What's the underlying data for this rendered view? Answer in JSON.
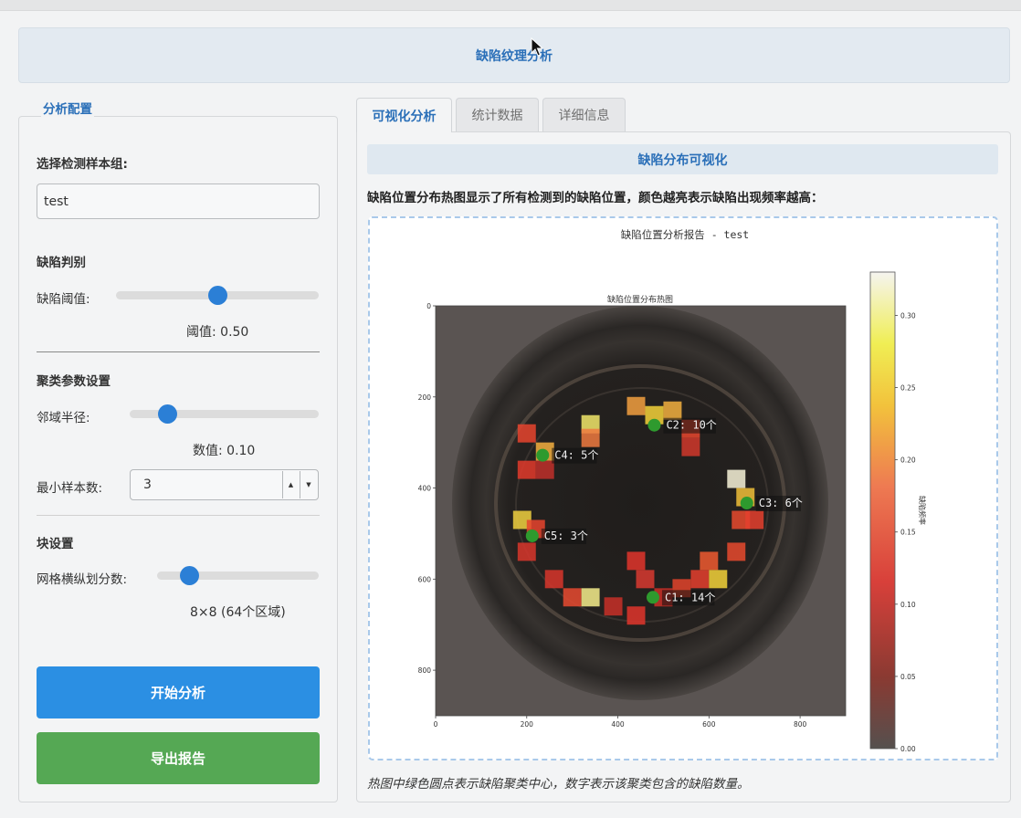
{
  "header": {
    "title": "缺陷纹理分析"
  },
  "config": {
    "group_title": "分析配置",
    "sample_group_label": "选择检测样本组:",
    "sample_group_value": "test",
    "defect_section": "缺陷判别",
    "threshold_label": "缺陷阈值:",
    "threshold_value": 0.5,
    "threshold_text": "阈值: 0.50",
    "cluster_section": "聚类参数设置",
    "radius_label": "邻域半径:",
    "radius_value": 0.1,
    "radius_text": "数值: 0.10",
    "min_samples_label": "最小样本数:",
    "min_samples_value": "3",
    "block_section": "块设置",
    "grid_label": "网格横纵划分数:",
    "grid_value": 8,
    "grid_text": "8×8 (64个区域)",
    "start_button": "开始分析",
    "export_button": "导出报告"
  },
  "tabs": [
    {
      "label": "可视化分析",
      "active": true
    },
    {
      "label": "统计数据",
      "active": false
    },
    {
      "label": "详细信息",
      "active": false
    }
  ],
  "visual": {
    "section_title": "缺陷分布可视化",
    "description": "缺陷位置分布热图显示了所有检测到的缺陷位置，颜色越亮表示缺陷出现频率越高：",
    "caption": "热图中绿色圆点表示缺陷聚类中心，数字表示该聚类包含的缺陷数量。"
  },
  "chart_data": {
    "type": "heatmap",
    "title": "缺陷位置分析报告 - test",
    "subtitle": "缺陷位置分布热图",
    "xlabel": "",
    "ylabel": "",
    "xlim": [
      0,
      900
    ],
    "ylim": [
      900,
      0
    ],
    "x_ticks": [
      0,
      200,
      400,
      600,
      800
    ],
    "y_ticks": [
      0,
      200,
      400,
      600,
      800
    ],
    "colorbar": {
      "label": "缺陷频率",
      "range": [
        0.0,
        0.33
      ],
      "ticks": [
        "0.00",
        "0.05",
        "0.10",
        "0.15",
        "0.20",
        "0.25",
        "0.30"
      ]
    },
    "clusters": [
      {
        "label": "C1: 14个",
        "x": 477,
        "y": 640
      },
      {
        "label": "C2: 10个",
        "x": 480,
        "y": 262
      },
      {
        "label": "C3: 6个",
        "x": 683,
        "y": 433
      },
      {
        "label": "C4: 5个",
        "x": 235,
        "y": 328
      },
      {
        "label": "C5: 3个",
        "x": 212,
        "y": 505
      }
    ]
  }
}
